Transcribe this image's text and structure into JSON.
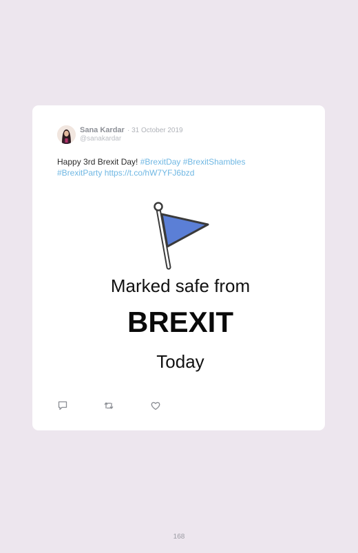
{
  "tweet": {
    "author_name": "Sana Kardar",
    "date": "· 31 October 2019",
    "handle": "@sanakardar",
    "text": "Happy 3rd Brexit Day! ",
    "hashtags": [
      "#BrexitDay",
      "#BrexitShambles",
      "#BrexitParty"
    ],
    "url": "https://t.co/hW7YFJ6bzd"
  },
  "media": {
    "line1": "Marked safe from",
    "line2": "BREXIT",
    "line3": "Today",
    "flag_icon": "flag-icon",
    "flag_color": "#5b7fd6"
  },
  "actions": [
    {
      "icon": "reply-icon"
    },
    {
      "icon": "retweet-icon"
    },
    {
      "icon": "like-icon"
    }
  ],
  "page": {
    "number": "168"
  },
  "colors": {
    "background": "#ede6ee",
    "card": "#ffffff",
    "link": "#6fb7e3"
  }
}
